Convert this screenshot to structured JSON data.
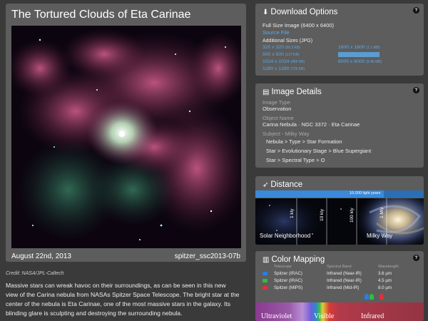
{
  "page": {
    "title": "The Tortured Clouds of Eta Carinae",
    "date": "August 22nd, 2013",
    "image_id": "spitzer_ssc2013-07b",
    "credit": "Credit: NASA/JPL-Caltech",
    "description": "Massive stars can wreak havoc on their surroundings, as can be seen in this new view of the Carina nebula from NASAs Spitzer Space Telescope. The bright star at the center of the nebula is Eta Carinae, one of the most massive stars in the galaxy. Its blinding glare is sculpting and destroying the surrounding nebula."
  },
  "download": {
    "title": "Download Options",
    "full_size": "Full Size Image (6400 x 6400)",
    "source": "Source File",
    "additional": "Additional Sizes (JPG)",
    "sizes": [
      {
        "label": "320 x 320",
        "size": "(56.3 KB)"
      },
      {
        "label": "500 x 500",
        "size": "(127 KB)"
      },
      {
        "label": "1024 x 1024",
        "size": "(469 KB)"
      },
      {
        "label": "1280 x 1280",
        "size": "(729 KB)"
      },
      {
        "label": "1600 x 1600",
        "size": "(1.1 MB)"
      },
      {
        "label": "2000 x 2000",
        "size": "(1.7 MB)"
      },
      {
        "label": "6000 x 6000",
        "size": "(9.46 MB)"
      }
    ]
  },
  "details": {
    "title": "Image Details",
    "type_label": "Image Type",
    "type_value": "Observation",
    "object_label": "Object Name",
    "object_value": "Carina Nebula · NGC 3372 · Eta Carinae",
    "subject_label": "Subject - Milky Way",
    "subjects": [
      "Nebula > Type > Star Formation",
      "Star > Evolutionary Stage > Blue Supergiant",
      "Star > Spectral Type > O"
    ]
  },
  "distance": {
    "title": "Distance",
    "scale_label": "10,000 light years",
    "ticks": [
      "1 kly",
      "10 kly",
      "100 kly",
      "1 Mly"
    ],
    "left_label": "Solar Neighborhood",
    "right_label": "Milky Way"
  },
  "color_mapping": {
    "title": "Color Mapping",
    "headers": {
      "telescope": "Telescope",
      "band": "Spectral Band",
      "wavelength": "Wavelength"
    },
    "rows": [
      {
        "telescope": "Spitzer (IRAC)",
        "band": "Infrared (Near-IR)",
        "wavelength": "3.6 µm",
        "color": "#2a7de1"
      },
      {
        "telescope": "Spitzer (IRAC)",
        "band": "Infrared (Near-IR)",
        "wavelength": "4.5 µm",
        "color": "#2fbf3a"
      },
      {
        "telescope": "Spitzer (MIPS)",
        "band": "Infrared (Mid-IR)",
        "wavelength": "8.0 µm",
        "color": "#e0303a"
      }
    ],
    "spectrum_labels": [
      "Ultraviolet",
      "Visible",
      "Infrared"
    ]
  },
  "icons": {
    "download": "download-icon",
    "details": "document-icon",
    "distance": "rocket-icon",
    "color": "map-icon",
    "help": "help-icon"
  }
}
